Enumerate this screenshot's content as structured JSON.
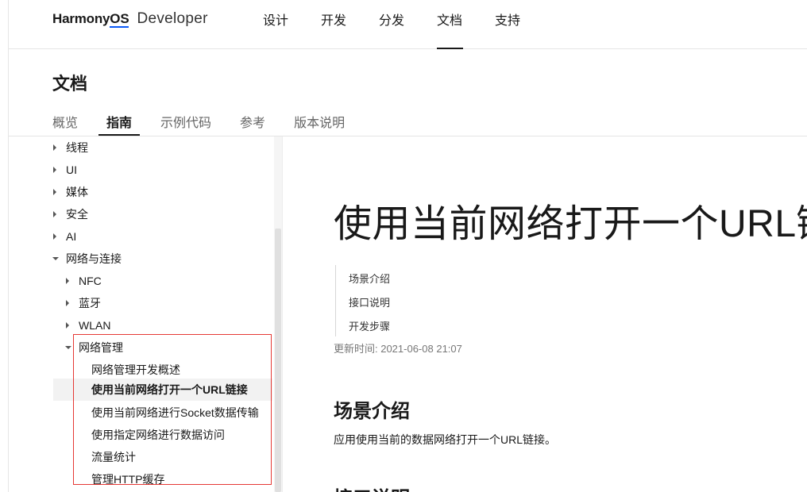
{
  "brand": {
    "main_prefix": "Harmony",
    "main_os": "OS",
    "sub": "Developer"
  },
  "topnav": {
    "items": [
      "设计",
      "开发",
      "分发",
      "文档",
      "支持"
    ],
    "active": "文档"
  },
  "doc": {
    "title": "文档",
    "tabs": [
      "概览",
      "指南",
      "示例代码",
      "参考",
      "版本说明"
    ],
    "active_tab": "指南"
  },
  "sidebar": {
    "items": [
      {
        "label": "线程",
        "caret": "right"
      },
      {
        "label": "UI",
        "caret": "right"
      },
      {
        "label": "媒体",
        "caret": "right"
      },
      {
        "label": "安全",
        "caret": "right"
      },
      {
        "label": "AI",
        "caret": "right"
      },
      {
        "label": "网络与连接",
        "caret": "down"
      },
      {
        "label": "NFC",
        "caret": "right"
      },
      {
        "label": "蓝牙",
        "caret": "right"
      },
      {
        "label": "WLAN",
        "caret": "right"
      },
      {
        "label": "网络管理",
        "caret": "down"
      },
      {
        "label": "网络管理开发概述",
        "caret": "none"
      },
      {
        "label": "使用当前网络打开一个URL链接",
        "caret": "none",
        "selected": true
      },
      {
        "label": "使用当前网络进行Socket数据传输",
        "caret": "none"
      },
      {
        "label": "使用指定网络进行数据访问",
        "caret": "none"
      },
      {
        "label": "流量统计",
        "caret": "none"
      },
      {
        "label": "管理HTTP缓存",
        "caret": "none"
      }
    ]
  },
  "article": {
    "title": "使用当前网络打开一个URL链",
    "toc": [
      "场景介绍",
      "接口说明",
      "开发步骤"
    ],
    "updated": "更新时间: 2021-06-08 21:07",
    "section1_heading": "场景介绍",
    "section1_text": "应用使用当前的数据网络打开一个URL链接。",
    "section2_heading": "接口说明"
  },
  "colors": {
    "accent": "#0a59f7",
    "highlight_box": "#e53935",
    "text": "#191919"
  }
}
